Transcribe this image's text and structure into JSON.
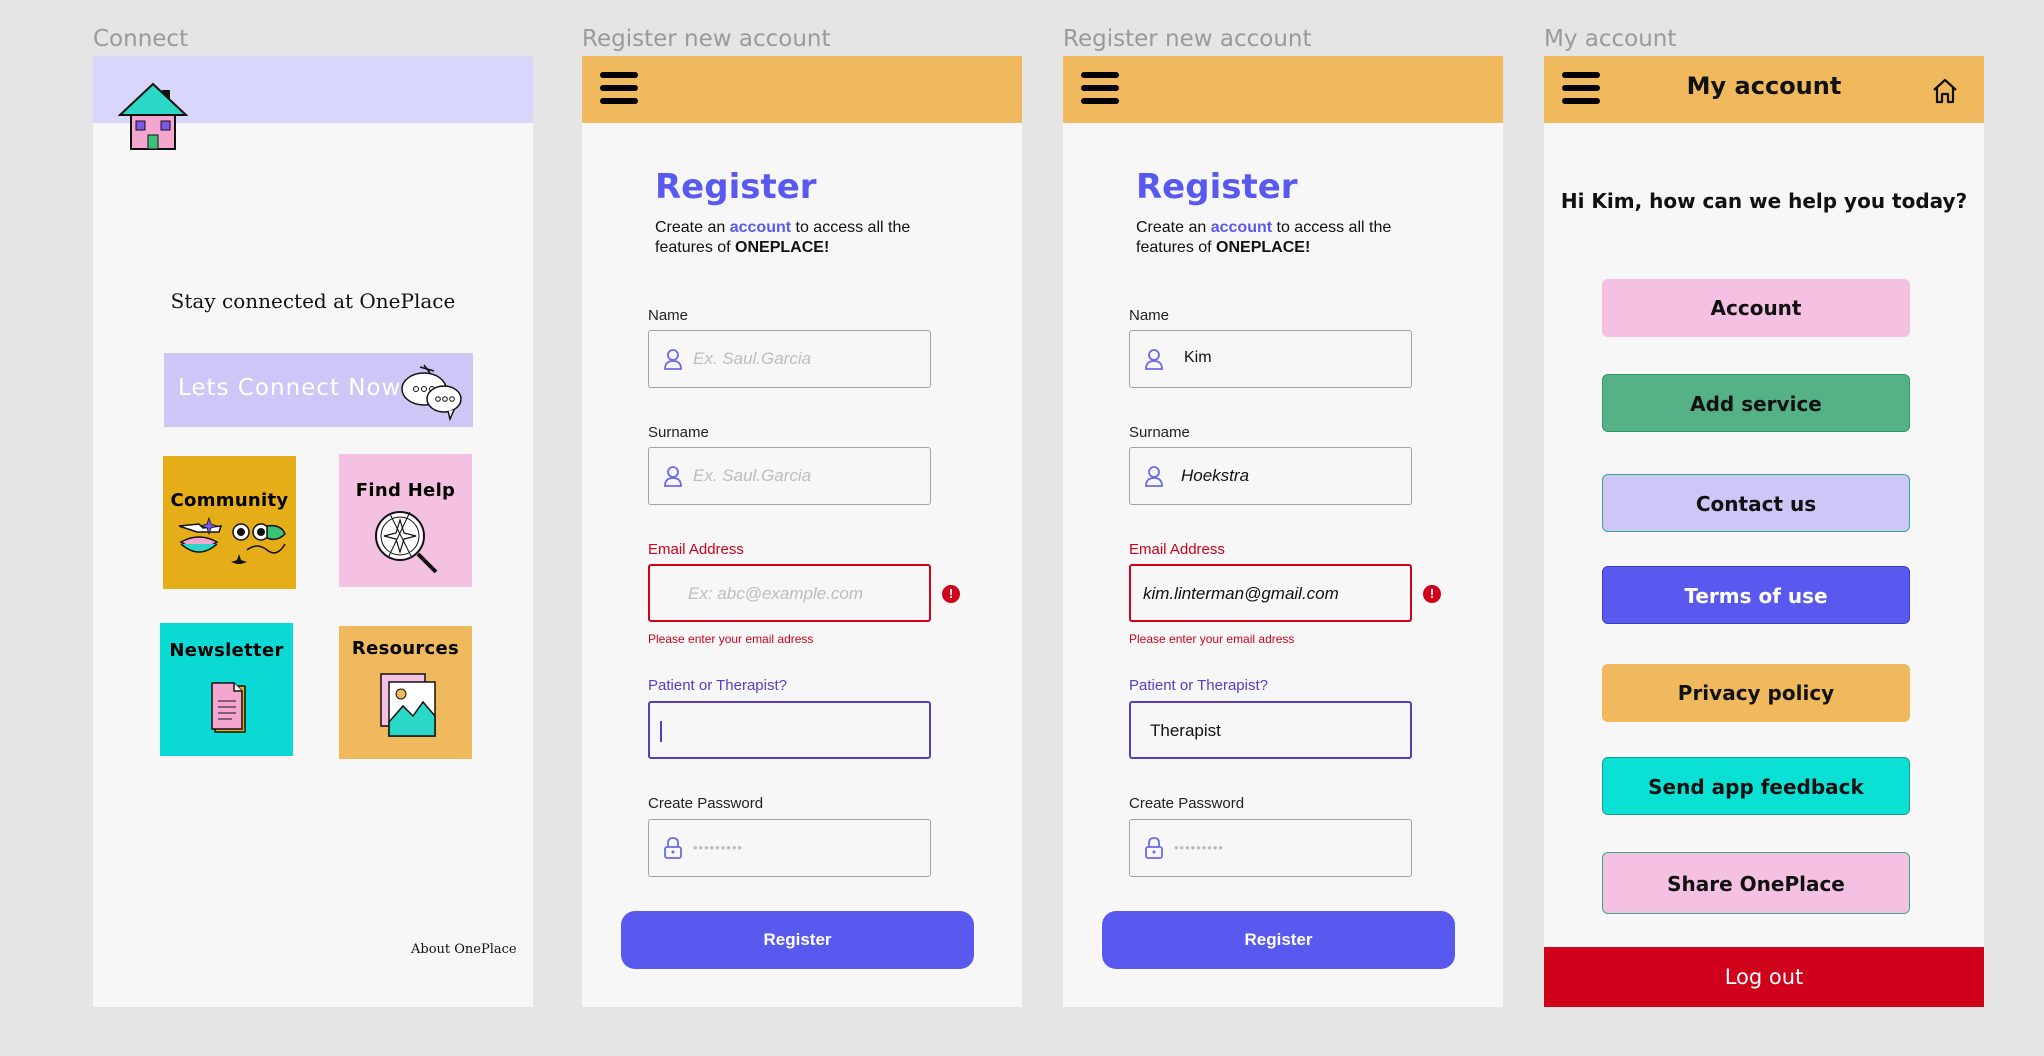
{
  "frames": {
    "connect": {
      "label": "Connect",
      "tagline": "Stay connected at OnePlace",
      "connect_button": "Lets Connect Now",
      "tiles": {
        "community": "Community",
        "find_help": "Find Help",
        "newsletter": "Newsletter",
        "resources": "Resources"
      },
      "footer_link": "About OnePlace",
      "colors": {
        "header": "#d8d6fa",
        "connect_button": "#cdc6f7",
        "community": "#e5ad18",
        "find_help": "#f4c1e3",
        "newsletter": "#0ad9d4",
        "resources": "#f0b95e"
      }
    },
    "register_empty": {
      "label": "Register new account",
      "title": "Register",
      "subtitle_pre": "Create an ",
      "subtitle_link": "account",
      "subtitle_mid": " to access all the features of ",
      "subtitle_brand": "ONEPLACE!",
      "name_label": "Name",
      "name_placeholder": "Ex. Saul.Garcia",
      "surname_label": "Surname",
      "surname_placeholder": "Ex. Saul.Garcia",
      "email_label": "Email Address",
      "email_placeholder": "Ex: abc@example.com",
      "email_error": "Please enter your email adress",
      "role_label": "Patient or Therapist?",
      "role_value": "",
      "password_label": "Create Password",
      "password_mask": "•••••••••",
      "submit": "Register"
    },
    "register_filled": {
      "label": "Register new account",
      "title": "Register",
      "subtitle_pre": "Create an ",
      "subtitle_link": "account",
      "subtitle_mid": " to access all the features of ",
      "subtitle_brand": "ONEPLACE!",
      "name_label": "Name",
      "name_value": "Kim",
      "surname_label": "Surname",
      "surname_value": "Hoekstra",
      "email_label": "Email Address",
      "email_value": "kim.linterman@gmail.com",
      "email_error": "Please enter your email adress",
      "role_label": "Patient or Therapist?",
      "role_value": "Therapist",
      "password_label": "Create Password",
      "password_mask": "•••••••••",
      "submit": "Register"
    },
    "my_account": {
      "label": "My account",
      "header_title": "My account",
      "greeting": "Hi Kim, how can we help you today?",
      "buttons": [
        {
          "label": "Account",
          "color": "#f4c1e3"
        },
        {
          "label": "Add service",
          "color": "#55b186"
        },
        {
          "label": "Contact us",
          "color": "#cdc6f7"
        },
        {
          "label": "Terms of use",
          "color": "#5959ef"
        },
        {
          "label": "Privacy policy",
          "color": "#f0b95e"
        },
        {
          "label": "Send app feedback",
          "color": "#0ae0d4"
        },
        {
          "label": "Share OnePlace",
          "color": "#f4c1e3"
        }
      ],
      "logout": "Log out",
      "logout_color": "#d0021b"
    }
  }
}
